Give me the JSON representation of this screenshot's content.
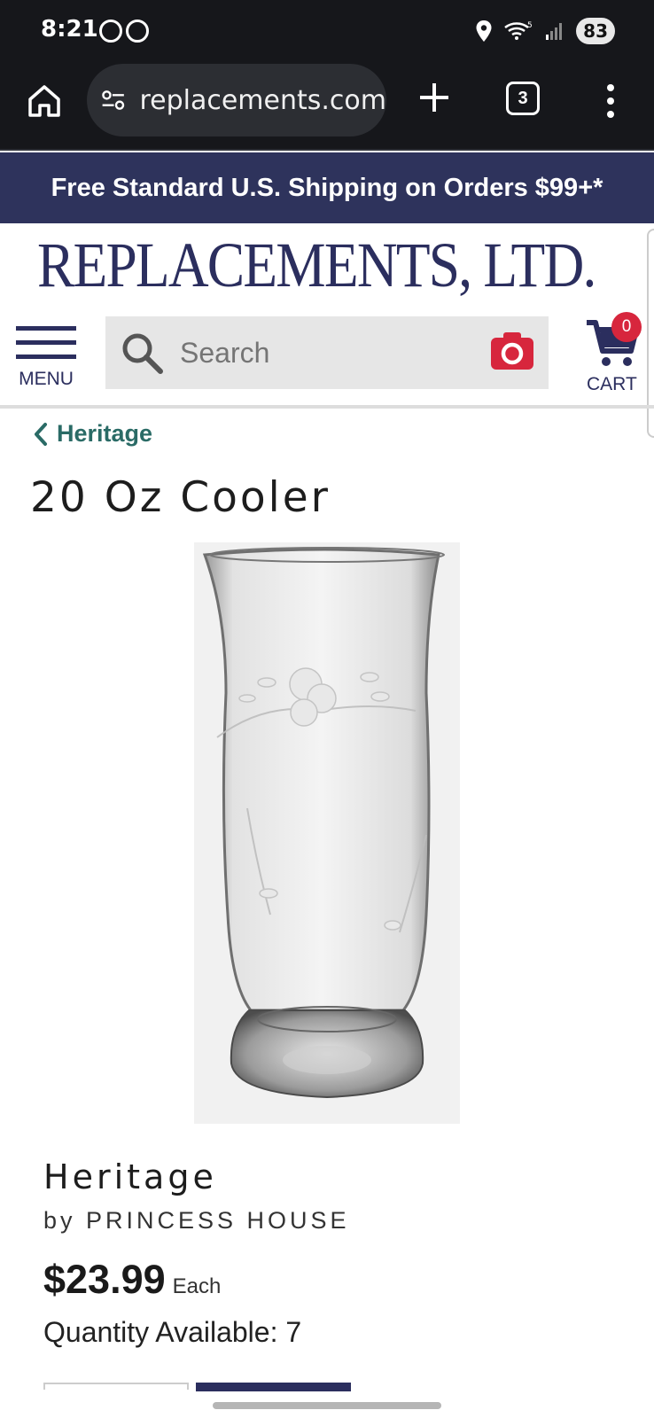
{
  "status_bar": {
    "time": "8:21",
    "battery": "83",
    "network": "5"
  },
  "browser": {
    "url": "replacements.com",
    "tab_count": "3"
  },
  "promo_banner": "Free Standard U.S. Shipping on Orders $99+*",
  "header": {
    "logo": "REPLACEMENTS, LTD.",
    "menu_label": "MENU",
    "search_placeholder": "Search",
    "cart_label": "CART",
    "cart_count": "0"
  },
  "breadcrumb": {
    "label": "Heritage"
  },
  "product": {
    "title": "20 Oz Cooler",
    "pattern": "Heritage",
    "brand": "by PRINCESS HOUSE",
    "price": "$23.99",
    "price_unit": "Each",
    "quantity_available": "Quantity Available: 7"
  },
  "colors": {
    "navy": "#2b2e5e",
    "promo_bg": "#2e335c",
    "teal_link": "#2a6b66",
    "camera_red": "#d7263d",
    "badge_red": "#d7263d"
  },
  "icons": [
    "home-icon",
    "site-settings-icon",
    "plus-icon",
    "more-vert-icon",
    "search-icon",
    "camera-icon",
    "cart-icon",
    "chevron-left-icon",
    "hamburger-icon",
    "location-icon",
    "wifi-icon",
    "signal-icon",
    "pinterest-icon",
    "threads-icon"
  ]
}
